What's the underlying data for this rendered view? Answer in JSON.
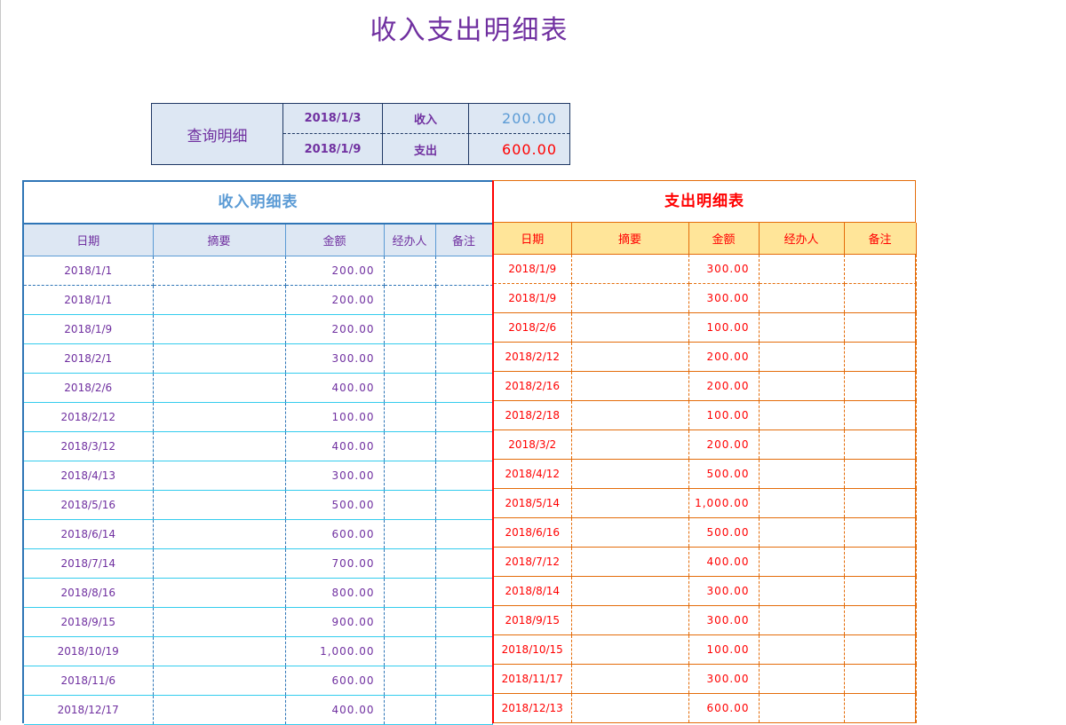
{
  "title": "收入支出明细表",
  "query": {
    "label": "查询明细",
    "start_date": "2018/1/3",
    "end_date": "2018/1/9",
    "income_label": "收入",
    "expense_label": "支出",
    "income_total": "200.00",
    "expense_total": "600.00"
  },
  "income": {
    "title": "收入明细表",
    "columns": [
      "日期",
      "摘要",
      "金额",
      "经办人",
      "备注"
    ],
    "rows": [
      {
        "date": "2018/1/1",
        "summary": "",
        "amount": "200.00",
        "handler": "",
        "note": ""
      },
      {
        "date": "2018/1/1",
        "summary": "",
        "amount": "200.00",
        "handler": "",
        "note": ""
      },
      {
        "date": "2018/1/9",
        "summary": "",
        "amount": "200.00",
        "handler": "",
        "note": ""
      },
      {
        "date": "2018/2/1",
        "summary": "",
        "amount": "300.00",
        "handler": "",
        "note": ""
      },
      {
        "date": "2018/2/6",
        "summary": "",
        "amount": "400.00",
        "handler": "",
        "note": ""
      },
      {
        "date": "2018/2/12",
        "summary": "",
        "amount": "100.00",
        "handler": "",
        "note": ""
      },
      {
        "date": "2018/3/12",
        "summary": "",
        "amount": "400.00",
        "handler": "",
        "note": ""
      },
      {
        "date": "2018/4/13",
        "summary": "",
        "amount": "300.00",
        "handler": "",
        "note": ""
      },
      {
        "date": "2018/5/16",
        "summary": "",
        "amount": "500.00",
        "handler": "",
        "note": ""
      },
      {
        "date": "2018/6/14",
        "summary": "",
        "amount": "600.00",
        "handler": "",
        "note": ""
      },
      {
        "date": "2018/7/14",
        "summary": "",
        "amount": "700.00",
        "handler": "",
        "note": ""
      },
      {
        "date": "2018/8/16",
        "summary": "",
        "amount": "800.00",
        "handler": "",
        "note": ""
      },
      {
        "date": "2018/9/15",
        "summary": "",
        "amount": "900.00",
        "handler": "",
        "note": ""
      },
      {
        "date": "2018/10/19",
        "summary": "",
        "amount": "1,000.00",
        "handler": "",
        "note": ""
      },
      {
        "date": "2018/11/6",
        "summary": "",
        "amount": "600.00",
        "handler": "",
        "note": ""
      },
      {
        "date": "2018/12/17",
        "summary": "",
        "amount": "400.00",
        "handler": "",
        "note": ""
      }
    ]
  },
  "expense": {
    "title": "支出明细表",
    "columns": [
      "日期",
      "摘要",
      "金额",
      "经办人",
      "备注"
    ],
    "rows": [
      {
        "date": "2018/1/9",
        "summary": "",
        "amount": "300.00",
        "handler": "",
        "note": ""
      },
      {
        "date": "2018/1/9",
        "summary": "",
        "amount": "300.00",
        "handler": "",
        "note": ""
      },
      {
        "date": "2018/2/6",
        "summary": "",
        "amount": "100.00",
        "handler": "",
        "note": ""
      },
      {
        "date": "2018/2/12",
        "summary": "",
        "amount": "200.00",
        "handler": "",
        "note": ""
      },
      {
        "date": "2018/2/16",
        "summary": "",
        "amount": "200.00",
        "handler": "",
        "note": ""
      },
      {
        "date": "2018/2/18",
        "summary": "",
        "amount": "100.00",
        "handler": "",
        "note": ""
      },
      {
        "date": "2018/3/2",
        "summary": "",
        "amount": "200.00",
        "handler": "",
        "note": ""
      },
      {
        "date": "2018/4/12",
        "summary": "",
        "amount": "500.00",
        "handler": "",
        "note": ""
      },
      {
        "date": "2018/5/14",
        "summary": "",
        "amount": "1,000.00",
        "handler": "",
        "note": ""
      },
      {
        "date": "2018/6/16",
        "summary": "",
        "amount": "500.00",
        "handler": "",
        "note": ""
      },
      {
        "date": "2018/7/12",
        "summary": "",
        "amount": "400.00",
        "handler": "",
        "note": ""
      },
      {
        "date": "2018/8/14",
        "summary": "",
        "amount": "300.00",
        "handler": "",
        "note": ""
      },
      {
        "date": "2018/9/15",
        "summary": "",
        "amount": "300.00",
        "handler": "",
        "note": ""
      },
      {
        "date": "2018/10/15",
        "summary": "",
        "amount": "100.00",
        "handler": "",
        "note": ""
      },
      {
        "date": "2018/11/17",
        "summary": "",
        "amount": "300.00",
        "handler": "",
        "note": ""
      },
      {
        "date": "2018/12/13",
        "summary": "",
        "amount": "600.00",
        "handler": "",
        "note": ""
      }
    ]
  }
}
